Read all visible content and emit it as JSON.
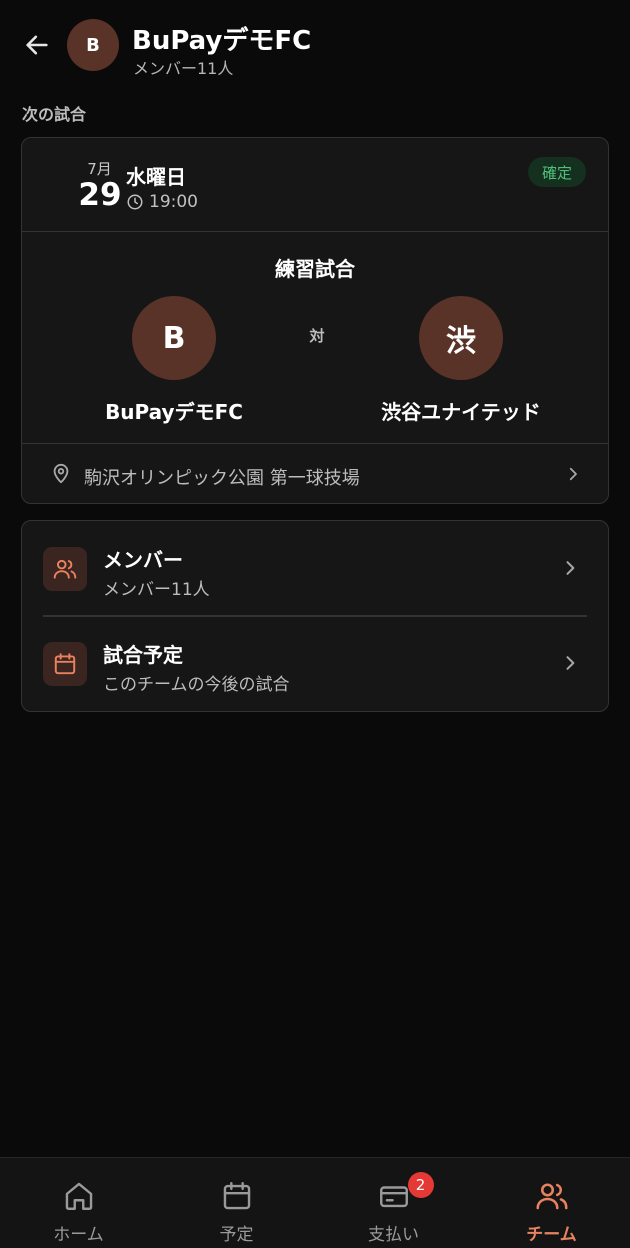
{
  "header": {
    "avatar_initial": "B",
    "title": "BuPayデモFC",
    "subtitle": "メンバー11人",
    "back_icon": "arrow-left-icon"
  },
  "next_match": {
    "section_label": "次の試合",
    "month": "7月",
    "day": "29",
    "weekday": "水曜日",
    "time": "19:00",
    "status": "確定",
    "status_color": "#4fc07a",
    "match_type": "練習試合",
    "vs_label": "対",
    "home": {
      "initial": "B",
      "name": "BuPayデモFC"
    },
    "away": {
      "initial": "渋",
      "name": "渋谷ユナイテッド"
    },
    "venue": "駒沢オリンピック公園 第一球技場"
  },
  "menu": {
    "items": [
      {
        "title": "メンバー",
        "subtitle": "メンバー11人",
        "icon": "users-icon"
      },
      {
        "title": "試合予定",
        "subtitle": "このチームの今後の試合",
        "icon": "calendar-icon"
      }
    ]
  },
  "tabbar": {
    "tabs": [
      {
        "label": "ホーム",
        "icon": "home-icon"
      },
      {
        "label": "予定",
        "icon": "calendar-icon"
      },
      {
        "label": "支払い",
        "icon": "card-icon",
        "badge": "2"
      },
      {
        "label": "チーム",
        "icon": "users-icon",
        "active": true
      }
    ]
  },
  "colors": {
    "accent": "#e8825f",
    "avatar_bg": "#5a3328",
    "background": "#0a0a0a",
    "badge_red": "#e53935"
  }
}
